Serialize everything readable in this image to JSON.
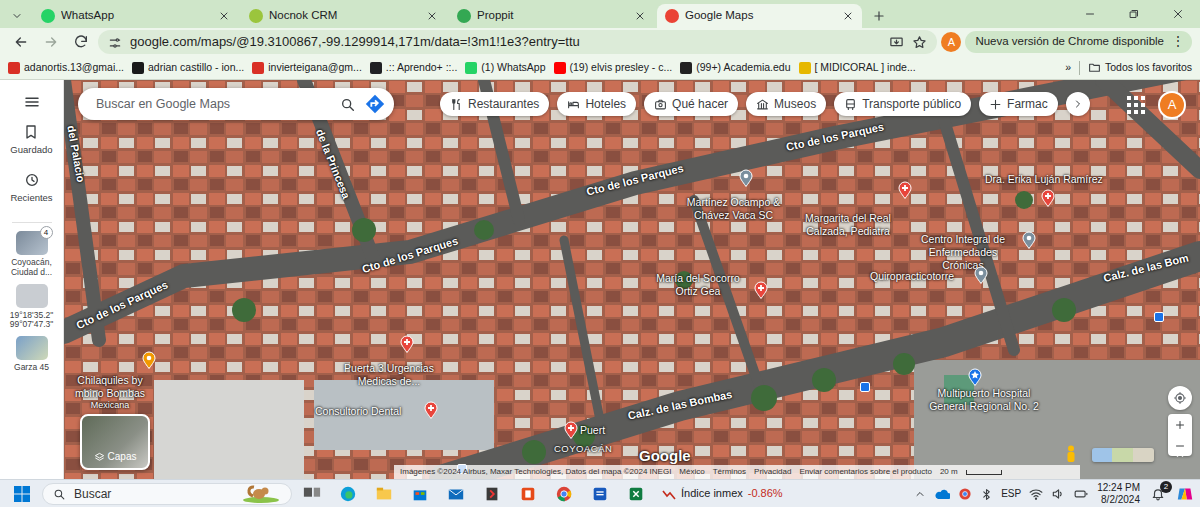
{
  "browser": {
    "tabs": [
      {
        "label": "WhatsApp",
        "selected": false
      },
      {
        "label": "Nocnok CRM",
        "selected": false
      },
      {
        "label": "Proppit",
        "selected": false
      },
      {
        "label": "Google Maps",
        "selected": true
      }
    ],
    "url": "google.com/maps/@19.3100867,-99.1299914,171m/data=!3m1!1e3?entry=ttu",
    "profile": "A",
    "update_button": "Nueva versión de Chrome disponible",
    "menu": "⋮",
    "bookmarks": [
      {
        "label": "adanortis.13@gmai..."
      },
      {
        "label": "adrian castillo - ion..."
      },
      {
        "label": "invierteigana@gm..."
      },
      {
        "label": ".:: Aprendo+ ::.."
      },
      {
        "label": "(1) WhatsApp"
      },
      {
        "label": "(19) elvis presley - c..."
      },
      {
        "label": "(99+) Academia.edu"
      },
      {
        "label": "[ MIDICORAL ] inde..."
      }
    ],
    "more_bookmarks": "»",
    "all_bookmarks": "Todos los favoritos"
  },
  "maps": {
    "sidebar": [
      {
        "label": "Guardado"
      },
      {
        "label": "Recientes"
      }
    ],
    "recents": [
      {
        "label": "Coyoacán, Ciudad d...",
        "badge": "4"
      },
      {
        "label": "19°18'35.2\" 99°07'47.3\""
      },
      {
        "label": "Garza 45"
      }
    ],
    "search": {
      "placeholder": "Buscar en Google Maps"
    },
    "chips": [
      {
        "label": "Restaurantes"
      },
      {
        "label": "Hoteles"
      },
      {
        "label": "Qué hacer"
      },
      {
        "label": "Museos"
      },
      {
        "label": "Transporte público"
      },
      {
        "label": "Farmac"
      }
    ],
    "avatar": "A",
    "streets": [
      {
        "label": "Cto de los Parques"
      },
      {
        "label": "Cto de los Parques"
      },
      {
        "label": "Cto de los Parques"
      },
      {
        "label": "Cto de los Parques"
      },
      {
        "label": "de la Princesa"
      },
      {
        "label": "del Palacio"
      },
      {
        "label": "Calz. de las Bombas"
      },
      {
        "label": "Calz. de las Bom"
      }
    ],
    "places": [
      {
        "label": "Martínez Ocampo & Chávez Vaca SC",
        "kind": "business"
      },
      {
        "label": "Margarita del Real Calzada, Pediatra",
        "kind": "medical"
      },
      {
        "label": "Dra. Erika Luján Ramírez",
        "kind": "medical"
      },
      {
        "label": "Centro Integral de Enfermedades Crónicas",
        "kind": "business"
      },
      {
        "label": "Quiropracticotorre",
        "kind": "business"
      },
      {
        "label": "María del Socorro Ortiz Gea",
        "kind": "medical"
      },
      {
        "label": "Puerta 3 Urgencias Medicas de...",
        "kind": "medical"
      },
      {
        "label": "Consultorio Dental",
        "kind": "medical"
      },
      {
        "label": "Chilaquiles by mbino Bombas",
        "category": "Mexicana",
        "kind": "restaurant"
      },
      {
        "label": "Puert",
        "kind": "medical"
      },
      {
        "label": "Multipuerto Hospital General Regional No. 2",
        "kind": "hospital"
      }
    ],
    "district": "COYOACÁN",
    "layers": "Capas",
    "logo": "Google",
    "attribution": "Imágenes ©2024 Airbus, Maxar Technologies, Datos del mapa ©2024 INEGI",
    "footer_links": [
      "México",
      "Términos",
      "Privacidad",
      "Enviar comentarios sobre el producto"
    ],
    "scale": "20 m"
  },
  "taskbar": {
    "search": "Buscar",
    "ticker": {
      "label": "Índice inmex",
      "value": "-0.86%"
    },
    "language": "ESP",
    "time": "12:24 PM",
    "date": "8/2/2024",
    "notifications": "2"
  }
}
